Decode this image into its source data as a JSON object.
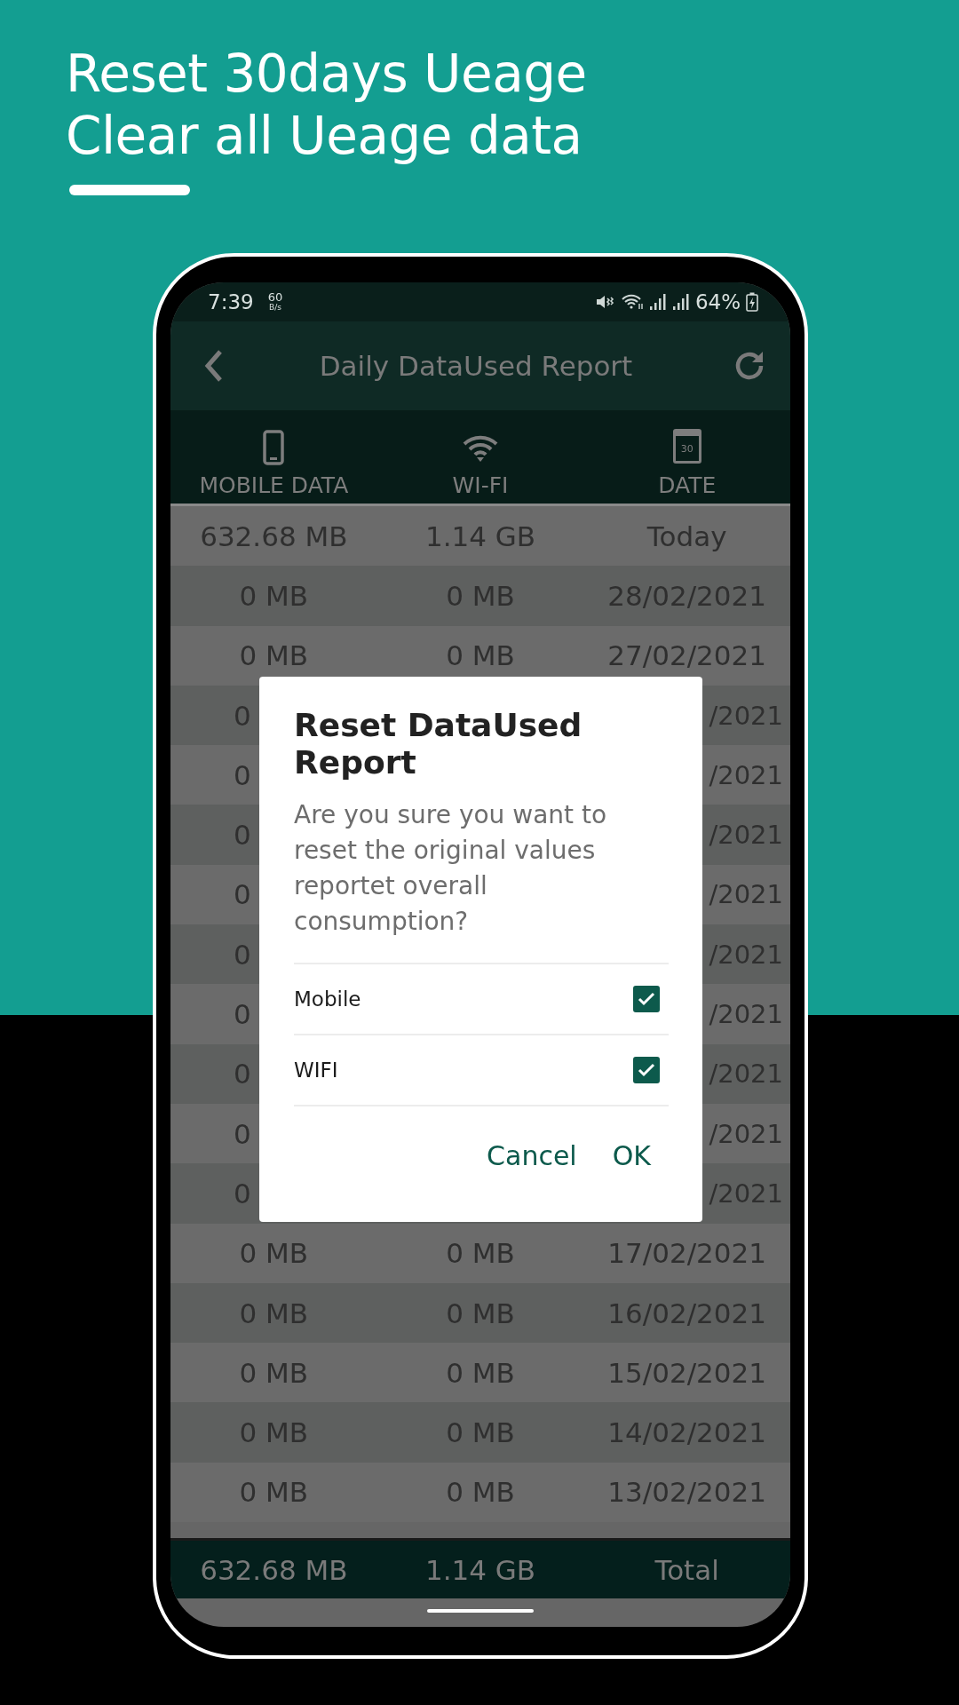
{
  "headline": [
    "Reset 30days Ueage",
    "Clear all Ueage data"
  ],
  "status_bar": {
    "time": "7:39",
    "net_speed": "60",
    "net_unit": "B/s",
    "battery": "64%"
  },
  "app_bar": {
    "title": "Daily DataUsed Report"
  },
  "table": {
    "columns": [
      {
        "label": "MOBILE DATA",
        "kind": "phone"
      },
      {
        "label": "WI-FI",
        "kind": "wifi"
      },
      {
        "label": "DATE",
        "kind": "calendar",
        "calendar_day": "30"
      }
    ],
    "rows": [
      {
        "kind": "full",
        "mobile": "632.68 MB",
        "wifi": "1.14 GB",
        "date": "Today"
      },
      {
        "kind": "full",
        "mobile": "0 MB",
        "wifi": "0 MB",
        "date": "28/02/2021"
      },
      {
        "kind": "full",
        "mobile": "0 MB",
        "wifi": "0 MB",
        "date": "27/02/2021"
      },
      {
        "kind": "covered",
        "mobile": "0",
        "date": "/2021"
      },
      {
        "kind": "covered",
        "mobile": "0",
        "date": "/2021"
      },
      {
        "kind": "covered",
        "mobile": "0",
        "date": "/2021"
      },
      {
        "kind": "covered",
        "mobile": "0",
        "date": "/2021"
      },
      {
        "kind": "covered",
        "mobile": "0",
        "date": "/2021"
      },
      {
        "kind": "covered",
        "mobile": "0",
        "date": "/2021"
      },
      {
        "kind": "covered",
        "mobile": "0",
        "date": "/2021"
      },
      {
        "kind": "covered",
        "mobile": "0",
        "date": "/2021"
      },
      {
        "kind": "covered",
        "mobile": "0",
        "date": "/2021"
      },
      {
        "kind": "full",
        "mobile": "0 MB",
        "wifi": "0 MB",
        "date": "17/02/2021"
      },
      {
        "kind": "full",
        "mobile": "0 MB",
        "wifi": "0 MB",
        "date": "16/02/2021"
      },
      {
        "kind": "full",
        "mobile": "0 MB",
        "wifi": "0 MB",
        "date": "15/02/2021"
      },
      {
        "kind": "full",
        "mobile": "0 MB",
        "wifi": "0 MB",
        "date": "14/02/2021"
      },
      {
        "kind": "full",
        "mobile": "0 MB",
        "wifi": "0 MB",
        "date": "13/02/2021"
      }
    ],
    "footer": {
      "mobile": "632.68 MB",
      "wifi": "1.14 GB",
      "label": "Total"
    }
  },
  "dialog": {
    "title": "Reset DataUsed Report",
    "message": "Are you sure you want to reset the original values reportet overall consumption?",
    "options": [
      {
        "label": "Mobile",
        "checked": true
      },
      {
        "label": "WIFI",
        "checked": true
      }
    ],
    "buttons": [
      "Cancel",
      "OK"
    ]
  }
}
